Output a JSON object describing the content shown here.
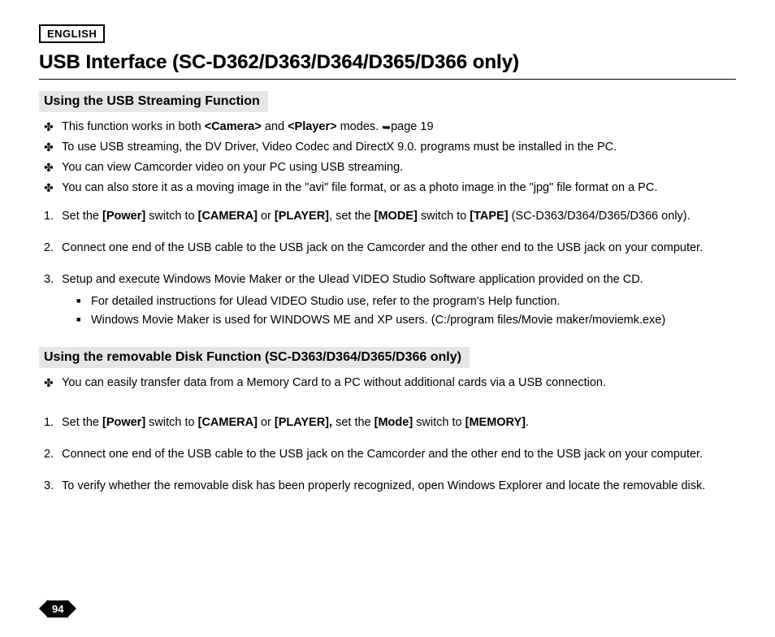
{
  "language_label": "ENGLISH",
  "page_title": "USB Interface (SC-D362/D363/D364/D365/D366 only)",
  "section1": {
    "heading": "Using the USB Streaming Function",
    "bullets": [
      {
        "pre": "This function works in both ",
        "b1": "<Camera>",
        "mid": " and ",
        "b2": "<Player>",
        "post": " modes. ",
        "arrow": "➥",
        "ref": "page 19"
      },
      {
        "text": "To use USB streaming, the DV Driver, Video Codec and DirectX 9.0. programs must be installed in the PC."
      },
      {
        "text": "You can view Camcorder video on your PC using USB streaming."
      },
      {
        "text": "You can also store it as a moving image in the \"avi\" file format, or as a photo image in the \"jpg\" file format on a PC."
      }
    ],
    "steps": [
      {
        "num": "1.",
        "parts": {
          "t1": "Set the ",
          "b1": "[Power]",
          "t2": " switch to ",
          "b2": "[CAMERA]",
          "t3": " or ",
          "b3": "[PLAYER]",
          "t4": ", set the ",
          "b4": "[MODE]",
          "t5": " switch to ",
          "b5": "[TAPE]",
          "t6": " (SC-D363/D364/D365/D366 only)."
        }
      },
      {
        "num": "2.",
        "text": "Connect one end of the USB cable to the USB jack on the Camcorder and the other end to the USB jack on your computer."
      },
      {
        "num": "3.",
        "text": "Setup and execute Windows Movie Maker or the Ulead VIDEO Studio Software application provided on the CD.",
        "subs": [
          "For detailed instructions for Ulead VIDEO Studio use, refer to the program's Help function.",
          "Windows Movie Maker is used for WINDOWS ME and XP users. (C:/program files/Movie maker/moviemk.exe)"
        ]
      }
    ]
  },
  "section2": {
    "heading": "Using the removable Disk Function (SC-D363/D364/D365/D366 only)",
    "bullets": [
      {
        "text": "You can easily transfer data from a Memory Card to a PC without additional cards via a USB connection."
      }
    ],
    "steps": [
      {
        "num": "1.",
        "parts": {
          "t1": "Set the ",
          "b1": "[Power]",
          "t2": " switch to ",
          "b2": "[CAMERA]",
          "t3": " or ",
          "b3": "[PLAYER],",
          "t4": " set the ",
          "b4": "[Mode]",
          "t5": " switch to ",
          "b5": "[MEMORY]",
          "t6": "."
        }
      },
      {
        "num": "2.",
        "text": "Connect one end of the USB cable to the USB jack on the Camcorder and the other end to the USB jack on your computer."
      },
      {
        "num": "3.",
        "text": "To verify whether the removable disk has been properly recognized, open Windows Explorer and locate the removable disk."
      }
    ]
  },
  "page_number": "94"
}
